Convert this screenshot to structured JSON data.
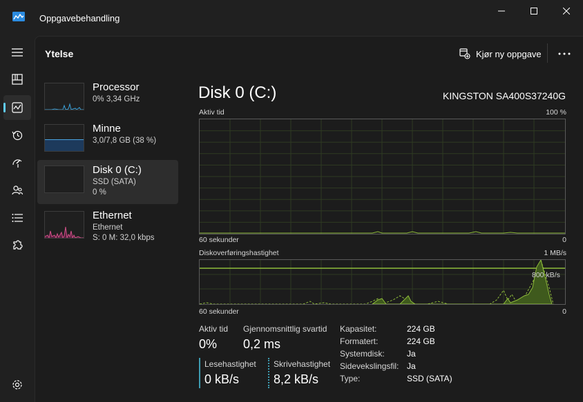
{
  "window": {
    "title": "Oppgavebehandling"
  },
  "header": {
    "page_title": "Ytelse",
    "run_task_label": "Kjør ny oppgave"
  },
  "sidebar": {
    "items": [
      {
        "name": "Processor",
        "line1": "0% 3,34 GHz",
        "line2": ""
      },
      {
        "name": "Minne",
        "line1": "3,0/7,8 GB (38 %)",
        "line2": ""
      },
      {
        "name": "Disk 0 (C:)",
        "line1": "SSD (SATA)",
        "line2": "0 %"
      },
      {
        "name": "Ethernet",
        "line1": "Ethernet",
        "line2": "S: 0 M: 32,0 kbps"
      }
    ]
  },
  "disk": {
    "title": "Disk 0 (C:)",
    "model": "KINGSTON SA400S37240G",
    "active_graph": {
      "label": "Aktiv tid",
      "max_label": "100 %",
      "x_label": "60 sekunder",
      "min_label": "0"
    },
    "transfer_graph": {
      "label": "Diskoverføringshastighet",
      "max_label": "1 MB/s",
      "ref_label": "800 kB/s",
      "x_label": "60 sekunder",
      "min_label": "0"
    },
    "stats": {
      "active_time_label": "Aktiv tid",
      "active_time_value": "0%",
      "response_label": "Gjennomsnittlig svartid",
      "response_value": "0,2 ms",
      "read_label": "Lesehastighet",
      "read_value": "0 kB/s",
      "write_label": "Skrivehastighet",
      "write_value": "8,2 kB/s"
    },
    "props": [
      {
        "label": "Kapasitet:",
        "value": "224 GB"
      },
      {
        "label": "Formatert:",
        "value": "224 GB"
      },
      {
        "label": "Systemdisk:",
        "value": "Ja"
      },
      {
        "label": "Sidevekslingsfil:",
        "value": "Ja"
      },
      {
        "label": "Type:",
        "value": "SSD (SATA)"
      }
    ]
  },
  "colors": {
    "disk_green": "#8fbc3b",
    "cpu_blue": "#3aa0d8",
    "mem_blue": "#4aa3e0",
    "net_pink": "#d05088",
    "accent": "#60cdff"
  },
  "icons": [
    "app-icon",
    "minimize-icon",
    "maximize-icon",
    "close-icon",
    "hamburger-icon",
    "processes-icon",
    "performance-icon",
    "history-icon",
    "startup-icon",
    "users-icon",
    "details-icon",
    "services-icon",
    "settings-icon",
    "run-task-icon",
    "more-icon"
  ]
}
